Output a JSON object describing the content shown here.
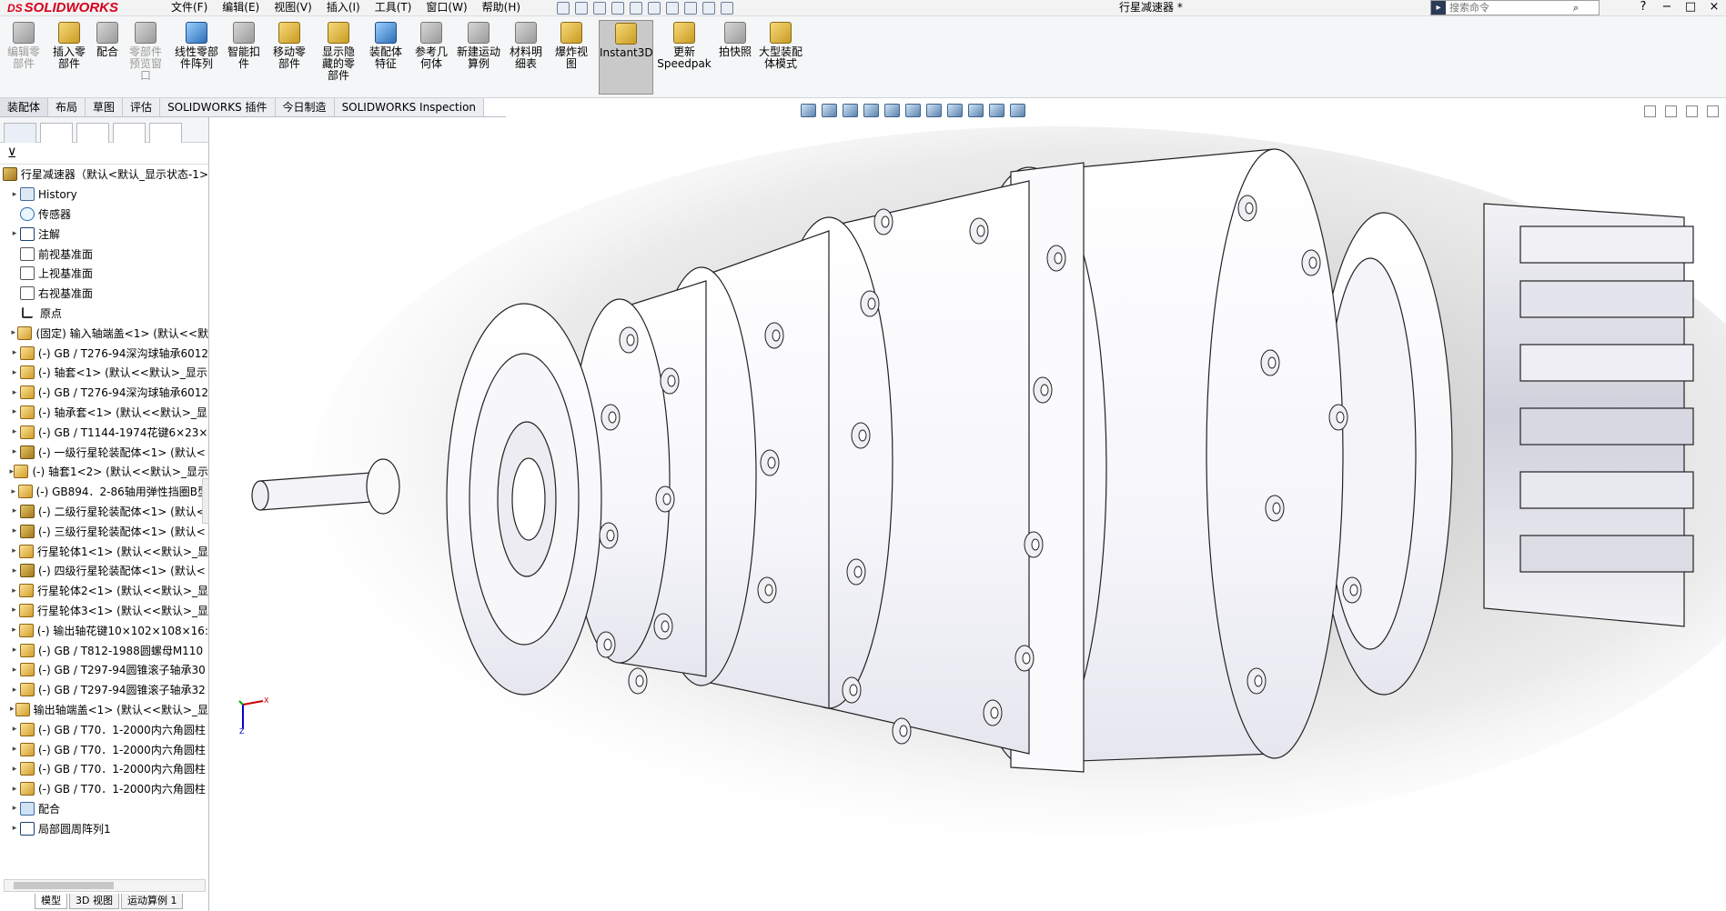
{
  "app": {
    "brand": "SOLIDWORKS",
    "doc_title": "行星减速器 *"
  },
  "menu": [
    "文件(F)",
    "编辑(E)",
    "视图(V)",
    "插入(I)",
    "工具(T)",
    "窗口(W)",
    "帮助(H)"
  ],
  "search": {
    "placeholder": "搜索命令"
  },
  "window_controls": [
    "?",
    "−",
    "□",
    "×"
  ],
  "ribbon": {
    "buttons": [
      {
        "label": "编辑零部件",
        "enabled": false
      },
      {
        "label": "插入零部件",
        "enabled": true
      },
      {
        "label": "配合",
        "enabled": true
      },
      {
        "label": "零部件预览窗口",
        "enabled": false
      },
      {
        "label": "线性零部件阵列",
        "enabled": true
      },
      {
        "label": "智能扣件",
        "enabled": true
      },
      {
        "label": "移动零部件",
        "enabled": true
      },
      {
        "label": "显示隐藏的零部件",
        "enabled": true
      },
      {
        "label": "装配体特征",
        "enabled": true
      },
      {
        "label": "参考几何体",
        "enabled": true
      },
      {
        "label": "新建运动算例",
        "enabled": true
      },
      {
        "label": "材料明细表",
        "enabled": true
      },
      {
        "label": "爆炸视图",
        "enabled": true
      },
      {
        "label": "Instant3D",
        "enabled": true,
        "active": true
      },
      {
        "label": "更新Speedpak",
        "enabled": true
      },
      {
        "label": "拍快照",
        "enabled": true
      },
      {
        "label": "大型装配体模式",
        "enabled": true
      }
    ]
  },
  "tabs": [
    "装配体",
    "布局",
    "草图",
    "评估",
    "SOLIDWORKS 插件",
    "今日制造",
    "SOLIDWORKS Inspection"
  ],
  "tree": {
    "root": "行星减速器（默认<默认_显示状态-1>",
    "items": [
      {
        "label": "History",
        "icon": "history-icon",
        "exp": true
      },
      {
        "label": "传感器",
        "icon": "sensor-icon",
        "exp": false
      },
      {
        "label": "注解",
        "icon": "annotation-icon",
        "exp": true
      },
      {
        "label": "前视基准面",
        "icon": "plane-icon",
        "exp": false
      },
      {
        "label": "上视基准面",
        "icon": "plane-icon",
        "exp": false
      },
      {
        "label": "右视基准面",
        "icon": "plane-icon",
        "exp": false
      },
      {
        "label": "原点",
        "icon": "origin-icon",
        "exp": false
      },
      {
        "label": "(固定) 输入轴端盖<1> (默认<<默",
        "icon": "part-icon",
        "exp": true
      },
      {
        "label": "(-) GB / T276-94深沟球轴承6012",
        "icon": "part-icon",
        "exp": true
      },
      {
        "label": "(-) 轴套<1> (默认<<默认>_显示",
        "icon": "part-icon",
        "exp": true
      },
      {
        "label": "(-) GB / T276-94深沟球轴承6012",
        "icon": "part-icon",
        "exp": true
      },
      {
        "label": "(-) 轴承套<1> (默认<<默认>_显",
        "icon": "part-icon",
        "exp": true
      },
      {
        "label": "(-) GB / T1144-1974花键6×23×",
        "icon": "part-icon",
        "exp": true
      },
      {
        "label": "(-) 一级行星轮装配体<1> (默认<",
        "icon": "assembly-icon",
        "exp": true
      },
      {
        "label": "(-) 轴套1<2> (默认<<默认>_显示",
        "icon": "part-icon",
        "exp": true
      },
      {
        "label": "(-) GB894．2-86轴用弹性挡圈B型",
        "icon": "part-icon",
        "exp": true
      },
      {
        "label": "(-) 二级行星轮装配体<1> (默认<",
        "icon": "assembly-icon",
        "exp": true
      },
      {
        "label": "(-) 三级行星轮装配体<1> (默认<",
        "icon": "assembly-icon",
        "exp": true
      },
      {
        "label": "行星轮体1<1> (默认<<默认>_显",
        "icon": "part-icon",
        "exp": true
      },
      {
        "label": "(-) 四级行星轮装配体<1> (默认<",
        "icon": "assembly-icon",
        "exp": true
      },
      {
        "label": "行星轮体2<1> (默认<<默认>_显",
        "icon": "part-icon",
        "exp": true
      },
      {
        "label": "行星轮体3<1> (默认<<默认>_显",
        "icon": "part-icon",
        "exp": true
      },
      {
        "label": "(-) 输出轴花键10×102×108×16:",
        "icon": "part-icon",
        "exp": true
      },
      {
        "label": "(-) GB / T812-1988圆螺母M110",
        "icon": "part-icon",
        "exp": true
      },
      {
        "label": "(-) GB / T297-94圆锥滚子轴承30",
        "icon": "part-icon",
        "exp": true
      },
      {
        "label": "(-) GB / T297-94圆锥滚子轴承32",
        "icon": "part-icon",
        "exp": true
      },
      {
        "label": "输出轴端盖<1> (默认<<默认>_显",
        "icon": "part-icon",
        "exp": true
      },
      {
        "label": "(-) GB / T70．1-2000内六角圆柱",
        "icon": "part-icon",
        "exp": true
      },
      {
        "label": "(-) GB / T70．1-2000内六角圆柱",
        "icon": "part-icon",
        "exp": true
      },
      {
        "label": "(-) GB / T70．1-2000内六角圆柱",
        "icon": "part-icon",
        "exp": true
      },
      {
        "label": "(-) GB / T70．1-2000内六角圆柱",
        "icon": "part-icon",
        "exp": true
      },
      {
        "label": "配合",
        "icon": "mate-icon",
        "exp": true
      },
      {
        "label": "局部圆周阵列1",
        "icon": "pattern-icon",
        "exp": true
      }
    ]
  },
  "bottom_tabs": [
    "模型",
    "3D 视图",
    "运动算例 1"
  ],
  "triad": {
    "x": "X",
    "y": "Y",
    "z": "Z"
  },
  "colors": {
    "brand": "#d6001c",
    "accent": "#2b3a55"
  }
}
